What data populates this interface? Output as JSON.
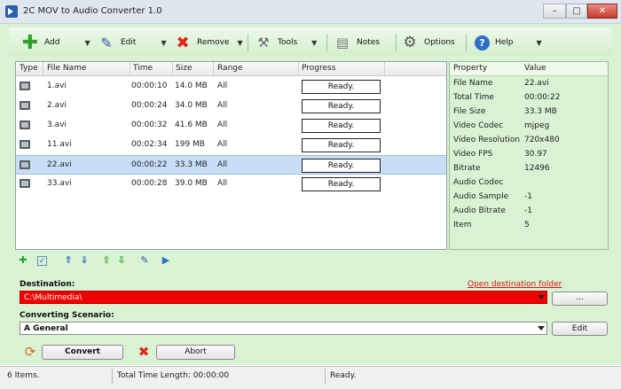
{
  "window": {
    "title": "2C MOV to Audio Converter 1.0",
    "controls": [
      "–",
      "□",
      "✕"
    ]
  },
  "toolbar": {
    "add": "Add",
    "edit": "Edit",
    "remove": "Remove",
    "tools": "Tools",
    "notes": "Notes",
    "options": "Options",
    "help": "Help"
  },
  "files": {
    "columns": [
      "Type",
      "File Name",
      "Time",
      "Size",
      "Range",
      "Progress"
    ],
    "rows": [
      {
        "name": "1.avi",
        "time": "00:00:10",
        "size": "14.0 MB",
        "range": "All",
        "progress": "Ready."
      },
      {
        "name": "2.avi",
        "time": "00:00:24",
        "size": "34.0 MB",
        "range": "All",
        "progress": "Ready."
      },
      {
        "name": "3.avi",
        "time": "00:00:32",
        "size": "41.6 MB",
        "range": "All",
        "progress": "Ready."
      },
      {
        "name": "11.avi",
        "time": "00:02:34",
        "size": "199 MB",
        "range": "All",
        "progress": "Ready."
      },
      {
        "name": "22.avi",
        "time": "00:00:22",
        "size": "33.3 MB",
        "range": "All",
        "progress": "Ready."
      },
      {
        "name": "33.avi",
        "time": "00:00:28",
        "size": "39.0 MB",
        "range": "All",
        "progress": "Ready."
      }
    ],
    "selected_row": 4
  },
  "properties": {
    "columns": [
      "Property",
      "Value"
    ],
    "rows": [
      {
        "k": "File Name",
        "v": "22.avi"
      },
      {
        "k": "Total Time",
        "v": "00:00:22"
      },
      {
        "k": "File Size",
        "v": "33.3 MB"
      },
      {
        "k": "Video Codec",
        "v": "mjpeg"
      },
      {
        "k": "Video Resolution",
        "v": "720x480"
      },
      {
        "k": "Video FPS",
        "v": "30.97"
      },
      {
        "k": "Bitrate",
        "v": "12496"
      },
      {
        "k": "Audio Codec",
        "v": ""
      },
      {
        "k": "Audio Sample",
        "v": "-1"
      },
      {
        "k": "Audio Bitrate",
        "v": "-1"
      },
      {
        "k": "Item",
        "v": "5"
      }
    ]
  },
  "destination": {
    "label": "Destination:",
    "value": "C:\\Multimedia\\",
    "open_link": "Open destination folder",
    "browse": "..."
  },
  "scenario": {
    "label": "Converting Scenario:",
    "value": "A General",
    "edit": "Edit"
  },
  "actions": {
    "convert": "Convert",
    "abort": "Abort"
  },
  "status": {
    "items": "6 Items.",
    "total_time": "Total Time Length: 00:00:00",
    "state": "Ready."
  },
  "colors": {
    "accent_green": "#d8f2d3",
    "destination_bg": "#ee0000",
    "selected_row": "#c8def7"
  }
}
